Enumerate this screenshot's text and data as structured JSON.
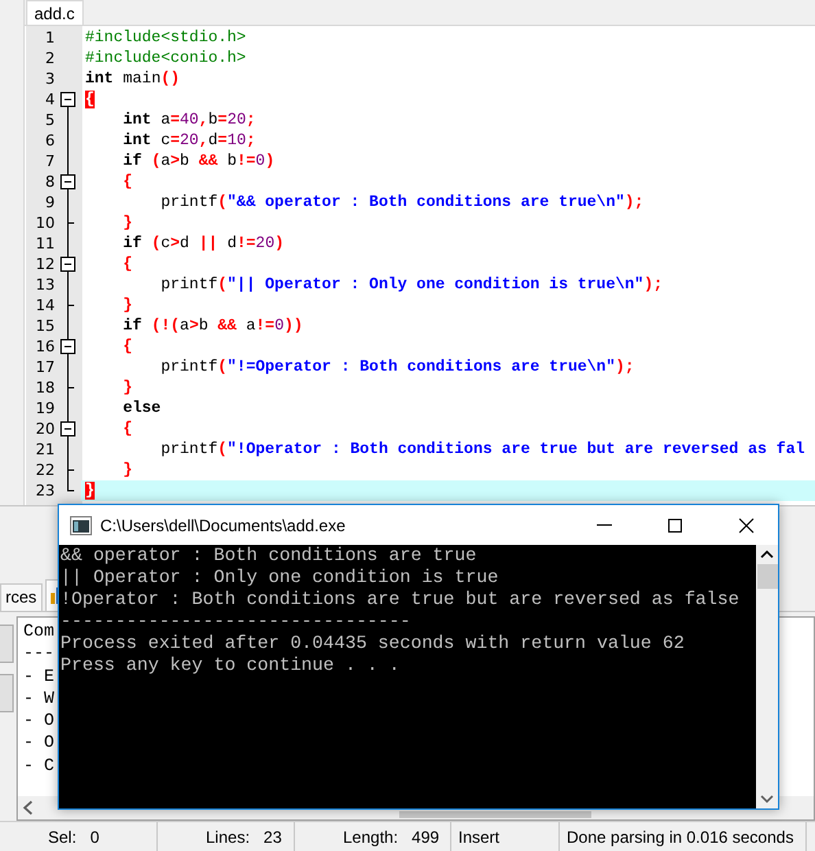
{
  "editor": {
    "tabs": [
      {
        "label": "add.c",
        "selected": true
      }
    ],
    "lines": [
      {
        "number": "1",
        "kind": "plain",
        "current": false,
        "tokens": [
          {
            "kind": "preprocessor",
            "text": "#include<stdio.h>"
          }
        ]
      },
      {
        "number": "2",
        "kind": "plain",
        "current": false,
        "tokens": [
          {
            "kind": "preprocessor",
            "text": "#include<conio.h>"
          }
        ]
      },
      {
        "number": "3",
        "kind": "plain",
        "current": false,
        "tokens": [
          {
            "kind": "keyword",
            "text": "int"
          },
          {
            "kind": "plain",
            "text": " main"
          },
          {
            "kind": "symbol",
            "text": "()"
          }
        ]
      },
      {
        "number": "4",
        "kind": "fold_start",
        "current": false,
        "tokens": [
          {
            "kind": "matched_brace",
            "text": "{"
          }
        ]
      },
      {
        "number": "5",
        "kind": "fold_inside",
        "current": false,
        "tokens": [
          {
            "kind": "keyword",
            "text": "    int"
          },
          {
            "kind": "plain",
            "text": " a"
          },
          {
            "kind": "symbol",
            "text": "="
          },
          {
            "kind": "number",
            "text": "40"
          },
          {
            "kind": "symbol",
            "text": ","
          },
          {
            "kind": "plain",
            "text": "b"
          },
          {
            "kind": "symbol",
            "text": "="
          },
          {
            "kind": "number",
            "text": "20"
          },
          {
            "kind": "symbol",
            "text": ";"
          }
        ]
      },
      {
        "number": "6",
        "kind": "fold_inside",
        "current": false,
        "tokens": [
          {
            "kind": "keyword",
            "text": "    int"
          },
          {
            "kind": "plain",
            "text": " c"
          },
          {
            "kind": "symbol",
            "text": "="
          },
          {
            "kind": "number",
            "text": "20"
          },
          {
            "kind": "symbol",
            "text": ","
          },
          {
            "kind": "plain",
            "text": "d"
          },
          {
            "kind": "symbol",
            "text": "="
          },
          {
            "kind": "number",
            "text": "10"
          },
          {
            "kind": "symbol",
            "text": ";"
          }
        ]
      },
      {
        "number": "7",
        "kind": "fold_inside",
        "current": false,
        "tokens": [
          {
            "kind": "keyword",
            "text": "    if"
          },
          {
            "kind": "symbol",
            "text": " ("
          },
          {
            "kind": "plain",
            "text": "a"
          },
          {
            "kind": "symbol",
            "text": ">"
          },
          {
            "kind": "plain",
            "text": "b "
          },
          {
            "kind": "symbol",
            "text": "&&"
          },
          {
            "kind": "plain",
            "text": " b"
          },
          {
            "kind": "symbol",
            "text": "!="
          },
          {
            "kind": "number",
            "text": "0"
          },
          {
            "kind": "symbol",
            "text": ")"
          }
        ]
      },
      {
        "number": "8",
        "kind": "fold_start",
        "current": false,
        "tokens": [
          {
            "kind": "symbol",
            "text": "    {"
          }
        ]
      },
      {
        "number": "9",
        "kind": "fold_inside",
        "current": false,
        "tokens": [
          {
            "kind": "plain",
            "text": "        printf"
          },
          {
            "kind": "symbol",
            "text": "("
          },
          {
            "kind": "string",
            "text": "\"&& operator : Both conditions are true\\n\""
          },
          {
            "kind": "symbol",
            "text": ");"
          }
        ]
      },
      {
        "number": "10",
        "kind": "fold_end",
        "current": false,
        "tokens": [
          {
            "kind": "symbol",
            "text": "    }"
          }
        ]
      },
      {
        "number": "11",
        "kind": "fold_inside",
        "current": false,
        "tokens": [
          {
            "kind": "keyword",
            "text": "    if"
          },
          {
            "kind": "symbol",
            "text": " ("
          },
          {
            "kind": "plain",
            "text": "c"
          },
          {
            "kind": "symbol",
            "text": ">"
          },
          {
            "kind": "plain",
            "text": "d "
          },
          {
            "kind": "symbol",
            "text": "||"
          },
          {
            "kind": "plain",
            "text": " d"
          },
          {
            "kind": "symbol",
            "text": "!="
          },
          {
            "kind": "number",
            "text": "20"
          },
          {
            "kind": "symbol",
            "text": ")"
          }
        ]
      },
      {
        "number": "12",
        "kind": "fold_start",
        "current": false,
        "tokens": [
          {
            "kind": "symbol",
            "text": "    {"
          }
        ]
      },
      {
        "number": "13",
        "kind": "fold_inside",
        "current": false,
        "tokens": [
          {
            "kind": "plain",
            "text": "        printf"
          },
          {
            "kind": "symbol",
            "text": "("
          },
          {
            "kind": "string",
            "text": "\"|| Operator : Only one condition is true\\n\""
          },
          {
            "kind": "symbol",
            "text": ");"
          }
        ]
      },
      {
        "number": "14",
        "kind": "fold_end",
        "current": false,
        "tokens": [
          {
            "kind": "symbol",
            "text": "    }"
          }
        ]
      },
      {
        "number": "15",
        "kind": "fold_inside",
        "current": false,
        "tokens": [
          {
            "kind": "keyword",
            "text": "    if"
          },
          {
            "kind": "symbol",
            "text": " (!("
          },
          {
            "kind": "plain",
            "text": "a"
          },
          {
            "kind": "symbol",
            "text": ">"
          },
          {
            "kind": "plain",
            "text": "b "
          },
          {
            "kind": "symbol",
            "text": "&&"
          },
          {
            "kind": "plain",
            "text": " a"
          },
          {
            "kind": "symbol",
            "text": "!="
          },
          {
            "kind": "number",
            "text": "0"
          },
          {
            "kind": "symbol",
            "text": "))"
          }
        ]
      },
      {
        "number": "16",
        "kind": "fold_start",
        "current": false,
        "tokens": [
          {
            "kind": "symbol",
            "text": "    {"
          }
        ]
      },
      {
        "number": "17",
        "kind": "fold_inside",
        "current": false,
        "tokens": [
          {
            "kind": "plain",
            "text": "        printf"
          },
          {
            "kind": "symbol",
            "text": "("
          },
          {
            "kind": "string",
            "text": "\"!=Operator : Both conditions are true\\n\""
          },
          {
            "kind": "symbol",
            "text": ");"
          }
        ]
      },
      {
        "number": "18",
        "kind": "fold_end",
        "current": false,
        "tokens": [
          {
            "kind": "symbol",
            "text": "    }"
          }
        ]
      },
      {
        "number": "19",
        "kind": "fold_inside",
        "current": false,
        "tokens": [
          {
            "kind": "keyword",
            "text": "    else"
          }
        ]
      },
      {
        "number": "20",
        "kind": "fold_start",
        "current": false,
        "tokens": [
          {
            "kind": "symbol",
            "text": "    {"
          }
        ]
      },
      {
        "number": "21",
        "kind": "fold_inside",
        "current": false,
        "tokens": [
          {
            "kind": "plain",
            "text": "        printf"
          },
          {
            "kind": "symbol",
            "text": "("
          },
          {
            "kind": "string",
            "text": "\"!Operator : Both conditions are true but are reversed as fal"
          }
        ]
      },
      {
        "number": "22",
        "kind": "fold_end",
        "current": false,
        "tokens": [
          {
            "kind": "symbol",
            "text": "    }"
          }
        ]
      },
      {
        "number": "23",
        "kind": "fold_last",
        "current": true,
        "tokens": [
          {
            "kind": "matched_brace",
            "text": "}"
          }
        ]
      }
    ]
  },
  "bottom_panel": {
    "tabs": [
      {
        "label": "rces",
        "kind": "text",
        "selected": false
      },
      {
        "kind": "chart",
        "selected": true
      }
    ],
    "compiler_log": [
      "Com",
      "---",
      "- E",
      "- W",
      "- O",
      "- O",
      "- C"
    ]
  },
  "console_window": {
    "title": "C:\\Users\\dell\\Documents\\add.exe",
    "output": [
      "&& operator : Both conditions are true",
      "|| Operator : Only one condition is true",
      "!Operator : Both conditions are true but are reversed as false",
      "--------------------------------",
      "Process exited after 0.04435 seconds with return value 62",
      "Press any key to continue . . ."
    ]
  },
  "status_bar": [
    {
      "label": "Sel:",
      "value": "0"
    },
    {
      "label": "Lines:",
      "value": "23"
    },
    {
      "label": "Length:",
      "value": "499"
    },
    {
      "value": "Insert"
    },
    {
      "value": "Done parsing in 0.016 seconds"
    }
  ]
}
